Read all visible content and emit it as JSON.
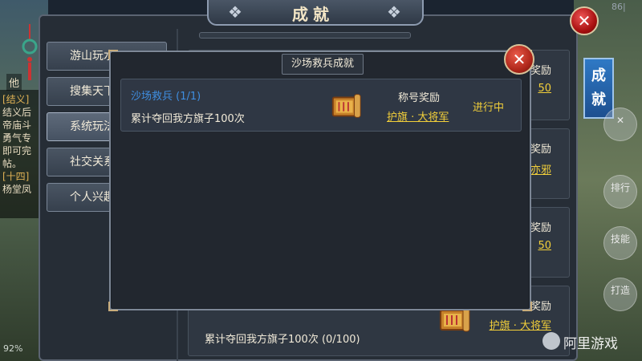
{
  "window": {
    "title": "成就",
    "top_right_number": "86|",
    "close_icon": "close-x-icon"
  },
  "nav": {
    "items": [
      {
        "label": "游山玩水",
        "active": false
      },
      {
        "label": "搜集天下",
        "active": false
      },
      {
        "label": "系统玩法",
        "active": true
      },
      {
        "label": "社交关系",
        "active": false
      },
      {
        "label": "个人兴趣",
        "active": false
      }
    ]
  },
  "background_list": {
    "rows": [
      {
        "reward_label": "奖励",
        "reward_value": "50"
      },
      {
        "reward_label": "奖励",
        "reward_value": "亦邪"
      },
      {
        "reward_label": "奖励",
        "reward_value": "50"
      },
      {
        "reward_label": "奖励",
        "reward_value": "护旗 · 大将军",
        "text": "累计夺回我方旗子100次 (0/100)"
      }
    ]
  },
  "side_tabs": {
    "achievement_tab": "成就",
    "icons": [
      {
        "label": "排行",
        "icon": "ranking-icon"
      },
      {
        "label": "技能",
        "icon": "skill-icon"
      },
      {
        "label": "打造",
        "icon": "forge-icon"
      }
    ]
  },
  "chat": {
    "lines": [
      "[结义]",
      "结义后",
      "帝庙斗",
      "勇气专",
      "即可完",
      "帖。",
      "[十四]",
      "杨堂凤"
    ],
    "side_char": "他"
  },
  "status": {
    "percent": "92%"
  },
  "popup": {
    "title": "沙场救兵成就",
    "achievement": {
      "name": "沙场救兵 (1/1)",
      "description": "累计夺回我方旗子100次",
      "reward_label": "称号奖励",
      "reward_value": "护旗 · 大将军",
      "status": "进行中",
      "icon": "scroll-reward-icon"
    }
  },
  "watermark": {
    "text": "阿里游戏"
  },
  "colors": {
    "link_yellow": "#f2cf3a",
    "name_blue": "#3f8ee0",
    "tab_blue": "#2f79c5",
    "close_red": "#b0281b"
  }
}
